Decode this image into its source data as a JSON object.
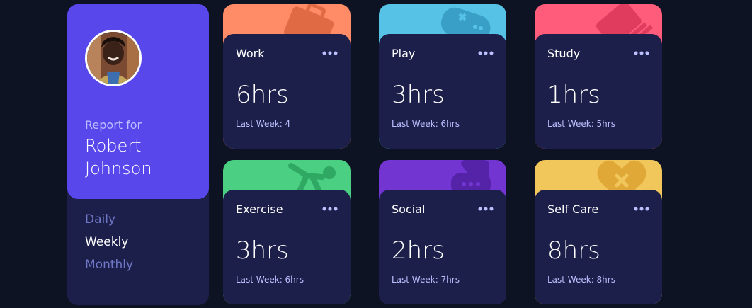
{
  "profile": {
    "report_label": "Report for",
    "name": "Robert Johnson",
    "periods": [
      {
        "label": "Daily",
        "active": false
      },
      {
        "label": "Weekly",
        "active": true
      },
      {
        "label": "Monthly",
        "active": false
      }
    ]
  },
  "cards": [
    {
      "title": "Work",
      "hours": "6hrs",
      "last": "Last Week: 4",
      "color": "#ff8c66",
      "icon": "briefcase-icon"
    },
    {
      "title": "Play",
      "hours": "3hrs",
      "last": "Last Week: 6hrs",
      "color": "#56c2e6",
      "icon": "gamepad-icon"
    },
    {
      "title": "Study",
      "hours": "1hrs",
      "last": "Last Week: 5hrs",
      "color": "#ff5c7c",
      "icon": "book-icon"
    },
    {
      "title": "Exercise",
      "hours": "3hrs",
      "last": "Last Week: 6hrs",
      "color": "#4bcf82",
      "icon": "running-icon"
    },
    {
      "title": "Social",
      "hours": "2hrs",
      "last": "Last Week: 7hrs",
      "color": "#7335d2",
      "icon": "chat-icon"
    },
    {
      "title": "Self Care",
      "hours": "8hrs",
      "last": "Last Week: 8hrs",
      "color": "#f1c65b",
      "icon": "heart-icon"
    }
  ],
  "colors": {
    "background": "#0e1323",
    "card": "#1c1f4a",
    "accent": "#5847eb",
    "muted": "#7078c9",
    "pale": "#bbc0ff"
  }
}
